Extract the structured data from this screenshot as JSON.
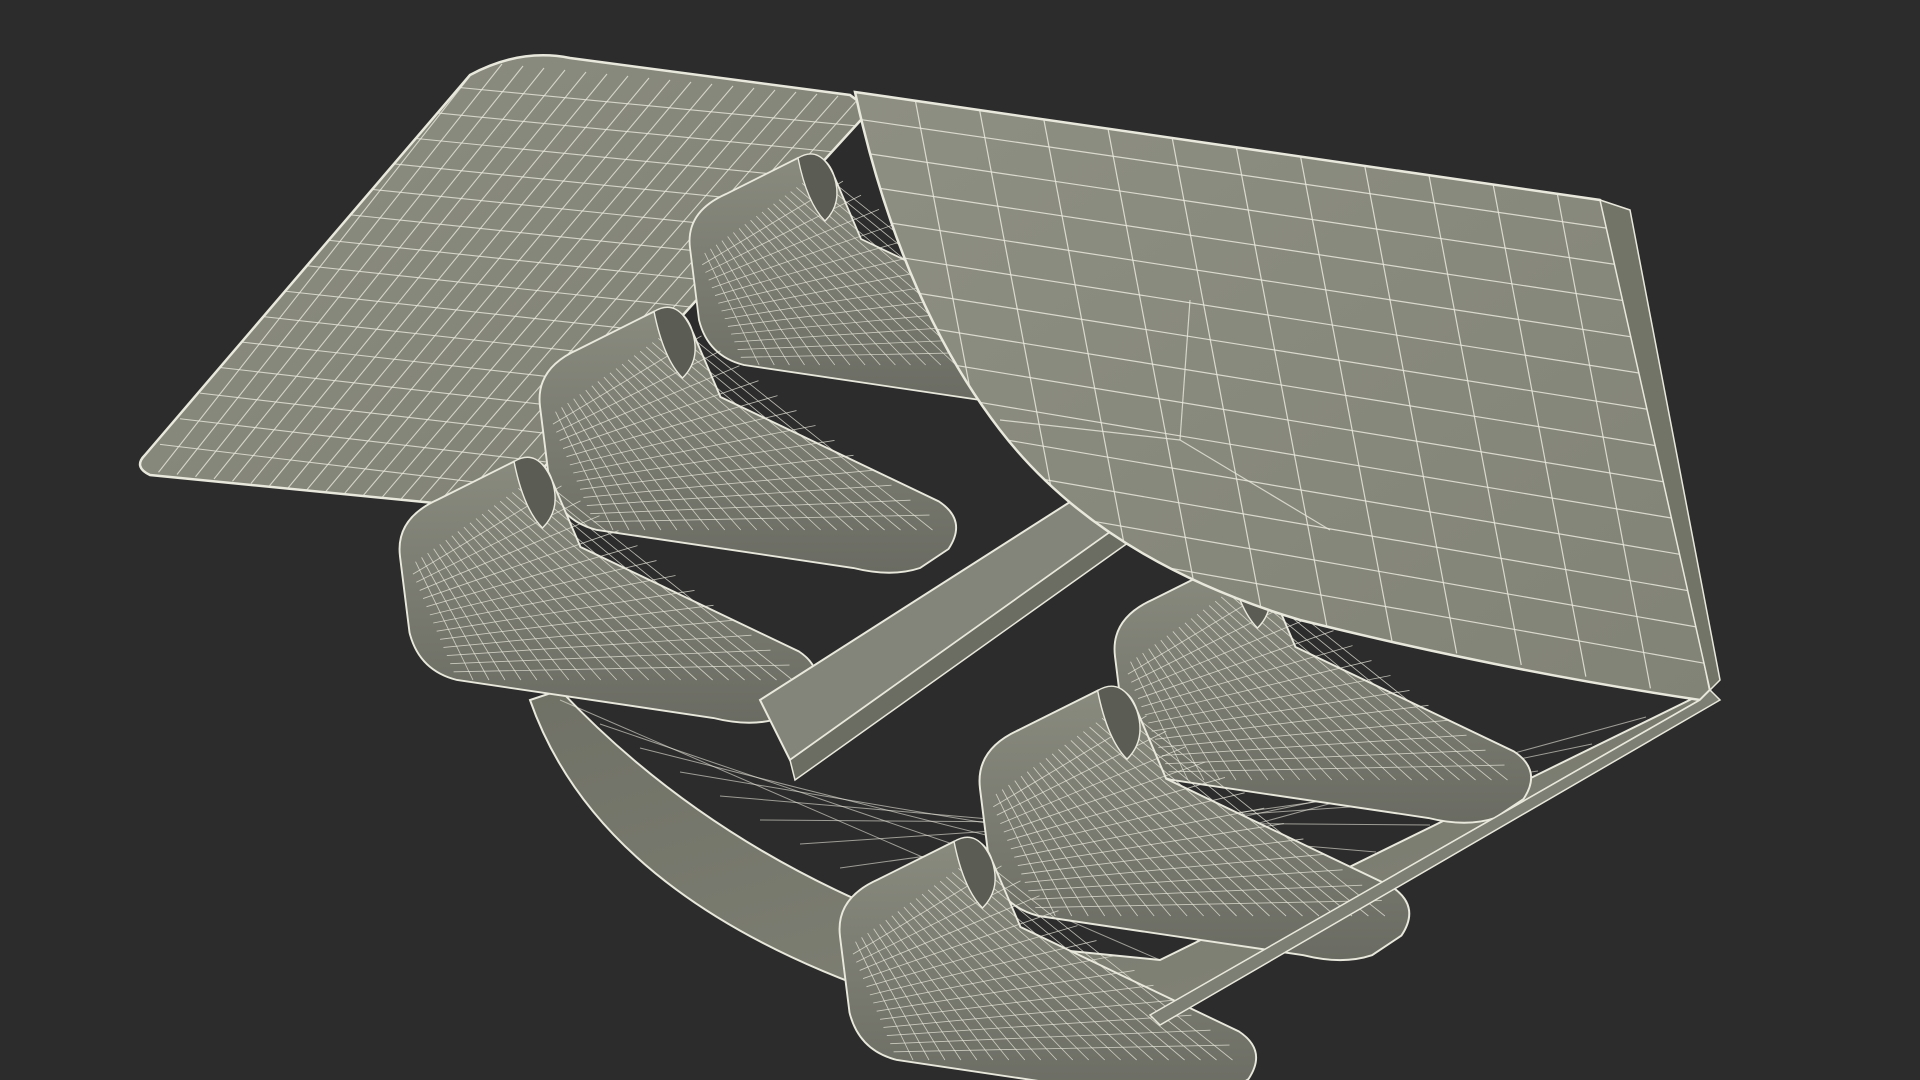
{
  "scene": {
    "subject": "wireframe-3d-model",
    "colors": {
      "background": "#2c2c2c",
      "panel_fill": "#8a8b7e",
      "panel_fill_shadow": "#6b6c62",
      "cushion_fill": "#7d7e73",
      "cushion_dark": "#5b5c54",
      "wire": "#e9e8dc",
      "rail_fill": "#7a7b70"
    },
    "wire_density": {
      "panel_rows": 14,
      "panel_cols": 16,
      "cushion_rows": 14,
      "cushion_cols": 22
    }
  }
}
